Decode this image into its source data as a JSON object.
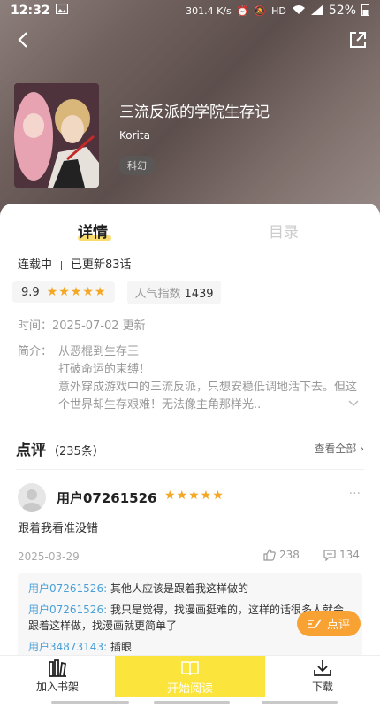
{
  "status_bar": {
    "time": "12:32",
    "network_speed": "301.4 K/s",
    "network_type": "HD",
    "battery": "52%"
  },
  "book": {
    "title": "三流反派的学院生存记",
    "author": "Korita",
    "tag": "科幻"
  },
  "tabs": [
    {
      "label": "详情",
      "active": true
    },
    {
      "label": "目录",
      "active": false
    }
  ],
  "details": {
    "status": "连载中",
    "updated": "已更新83话",
    "score": "9.9",
    "stars": 5,
    "popularity_label": "人气指数",
    "popularity_value": "1439",
    "time_line": "时间：2025-07-02 更新",
    "intro_label": "简介：",
    "intro_lines": [
      "从恶棍到生存王",
      "打破命运的束缚！",
      "意外穿成游戏中的三流反派，只想安稳低调地活下去。但这个世界却生存艰难！无法像主角那样光.."
    ]
  },
  "reviews": {
    "title": "点评",
    "count": "（235条）",
    "view_all": "查看全部",
    "items": [
      {
        "user": "用户07261526",
        "stars": 5,
        "text": "跟着我看准没错",
        "date": "2025-03-29",
        "likes": "238",
        "replies": "134",
        "reply_list": [
          {
            "user": "用户07261526:",
            "text": " 其他人应该是跟着我这样做的"
          },
          {
            "user": "用户07261526:",
            "text": " 我只是觉得，找漫画挺难的，这样的话很多人就会跟着这样做，找漫画就更简单了"
          },
          {
            "user": "用户34873143:",
            "text": " 插眼"
          }
        ]
      }
    ]
  },
  "fab_label": "点评",
  "bottom_bar": {
    "shelf": "加入书架",
    "read": "开始阅读",
    "download": "下载"
  },
  "colors": {
    "accent_yellow": "#fbe43b",
    "star": "#f5a623",
    "fab": "#f7a233",
    "reply_user": "#4aa0d8"
  }
}
